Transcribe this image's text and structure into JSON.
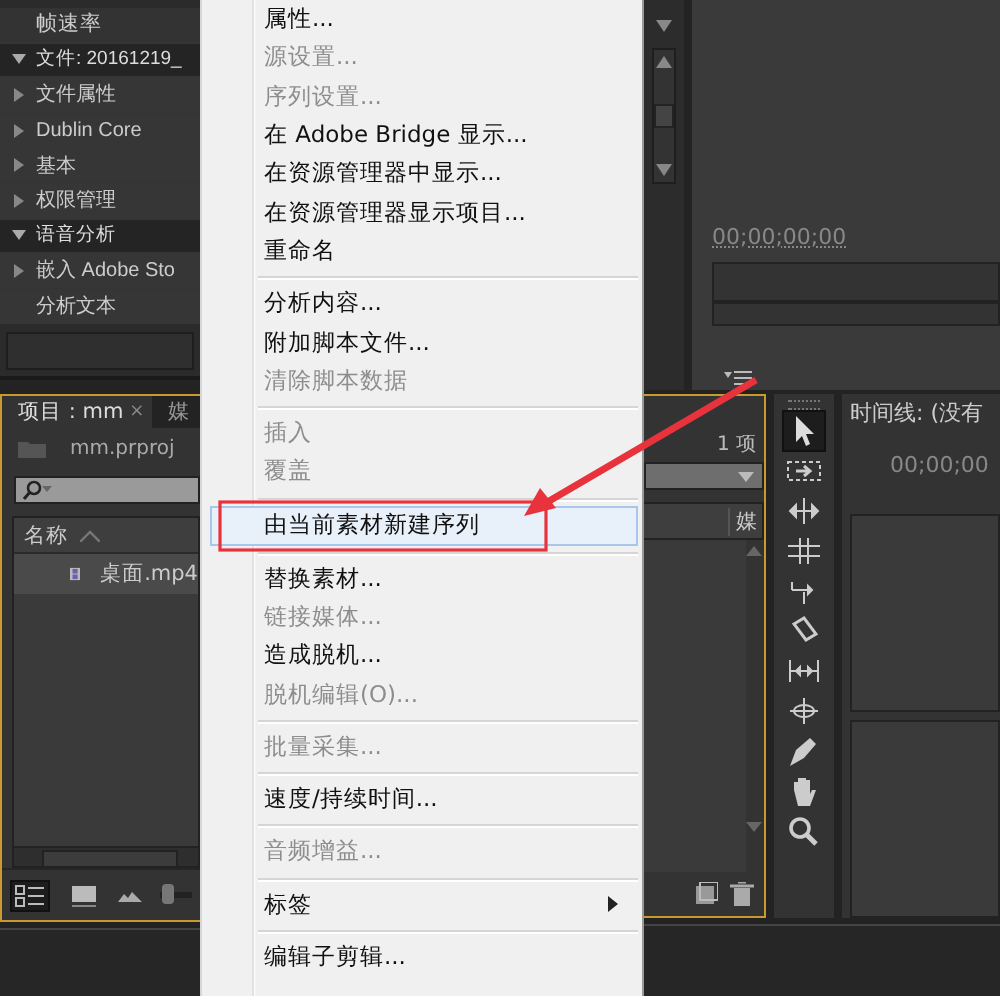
{
  "metadata_panel": {
    "items": [
      {
        "label": "帧速率",
        "kind": "field"
      },
      {
        "label": "文件: 20161219_",
        "kind": "section",
        "expanded": true,
        "children": [
          {
            "label": "文件属性",
            "kind": "group",
            "expanded": false
          },
          {
            "label": "Dublin Core",
            "kind": "group",
            "expanded": false
          },
          {
            "label": "基本",
            "kind": "group",
            "expanded": false
          },
          {
            "label": "权限管理",
            "kind": "group",
            "expanded": false
          }
        ]
      },
      {
        "label": "语音分析",
        "kind": "section",
        "expanded": true,
        "children": [
          {
            "label": "嵌入 Adobe Sto",
            "kind": "group",
            "expanded": false
          },
          {
            "label": "分析文本",
            "kind": "field"
          }
        ]
      }
    ]
  },
  "project_panel": {
    "tabs": [
      {
        "label": "项目 : mm",
        "close": "×",
        "selected": true
      },
      {
        "label": "媒",
        "selected": false
      }
    ],
    "file": "mm.prproj",
    "item_count": "1 项",
    "columns": [
      "名称",
      "媒"
    ],
    "rows": [
      {
        "name": "桌面.mp4",
        "selected": true
      }
    ],
    "zoom_slider": {
      "level": 0.05
    },
    "views": [
      {
        "kind": "list",
        "selected": true
      },
      {
        "kind": "icon",
        "selected": false
      }
    ]
  },
  "context_menu": {
    "groups": [
      [
        {
          "label": "属性...",
          "disabled": false,
          "selected": false,
          "submenu": false
        },
        {
          "label": "源设置...",
          "disabled": true,
          "selected": false,
          "submenu": false
        },
        {
          "label": "序列设置...",
          "disabled": true,
          "selected": false,
          "submenu": false
        },
        {
          "label": "在 Adobe Bridge 显示...",
          "disabled": false,
          "selected": false,
          "submenu": false
        },
        {
          "label": "在资源管理器中显示...",
          "disabled": false,
          "selected": false,
          "submenu": false
        },
        {
          "label": "在资源管理器显示项目...",
          "disabled": false,
          "selected": false,
          "submenu": false
        },
        {
          "label": "重命名",
          "disabled": false,
          "selected": false,
          "submenu": false
        }
      ],
      [
        {
          "label": "分析内容...",
          "disabled": false,
          "selected": false,
          "submenu": false
        },
        {
          "label": "附加脚本文件...",
          "disabled": false,
          "selected": false,
          "submenu": false
        },
        {
          "label": "清除脚本数据",
          "disabled": true,
          "selected": false,
          "submenu": false
        }
      ],
      [
        {
          "label": "插入",
          "disabled": true,
          "selected": false,
          "submenu": false
        },
        {
          "label": "覆盖",
          "disabled": true,
          "selected": false,
          "submenu": false
        }
      ],
      [
        {
          "label": "由当前素材新建序列",
          "disabled": false,
          "selected": true,
          "submenu": false
        }
      ],
      [
        {
          "label": "替换素材...",
          "disabled": false,
          "selected": false,
          "submenu": false
        },
        {
          "label": "链接媒体...",
          "disabled": true,
          "selected": false,
          "submenu": false
        },
        {
          "label": "造成脱机...",
          "disabled": false,
          "selected": false,
          "submenu": false
        },
        {
          "label": "脱机编辑(O)...",
          "disabled": true,
          "selected": false,
          "submenu": false
        }
      ],
      [
        {
          "label": "批量采集...",
          "disabled": true,
          "selected": false,
          "submenu": false
        }
      ],
      [
        {
          "label": "速度/持续时间...",
          "disabled": false,
          "selected": false,
          "submenu": false
        }
      ],
      [
        {
          "label": "音频增益...",
          "disabled": true,
          "selected": false,
          "submenu": false
        }
      ],
      [
        {
          "label": "标签",
          "disabled": false,
          "selected": false,
          "submenu": true
        }
      ],
      [
        {
          "label": "编辑子剪辑...",
          "disabled": false,
          "selected": false,
          "submenu": false
        }
      ]
    ]
  },
  "monitor": {
    "timecode": "00;00;00;00"
  },
  "tools": [
    {
      "kind": "select",
      "selected": true
    },
    {
      "kind": "track",
      "selected": false
    },
    {
      "kind": "ripple",
      "selected": false
    },
    {
      "kind": "rolling",
      "selected": false
    },
    {
      "kind": "rate",
      "selected": false
    },
    {
      "kind": "razor",
      "selected": false
    },
    {
      "kind": "slip",
      "selected": false
    },
    {
      "kind": "slide",
      "selected": false
    },
    {
      "kind": "pen",
      "selected": false
    },
    {
      "kind": "hand",
      "selected": false
    },
    {
      "kind": "zoom",
      "selected": false
    }
  ],
  "timeline": {
    "title": "时间线: (没有",
    "timecode": "00;00;00"
  }
}
